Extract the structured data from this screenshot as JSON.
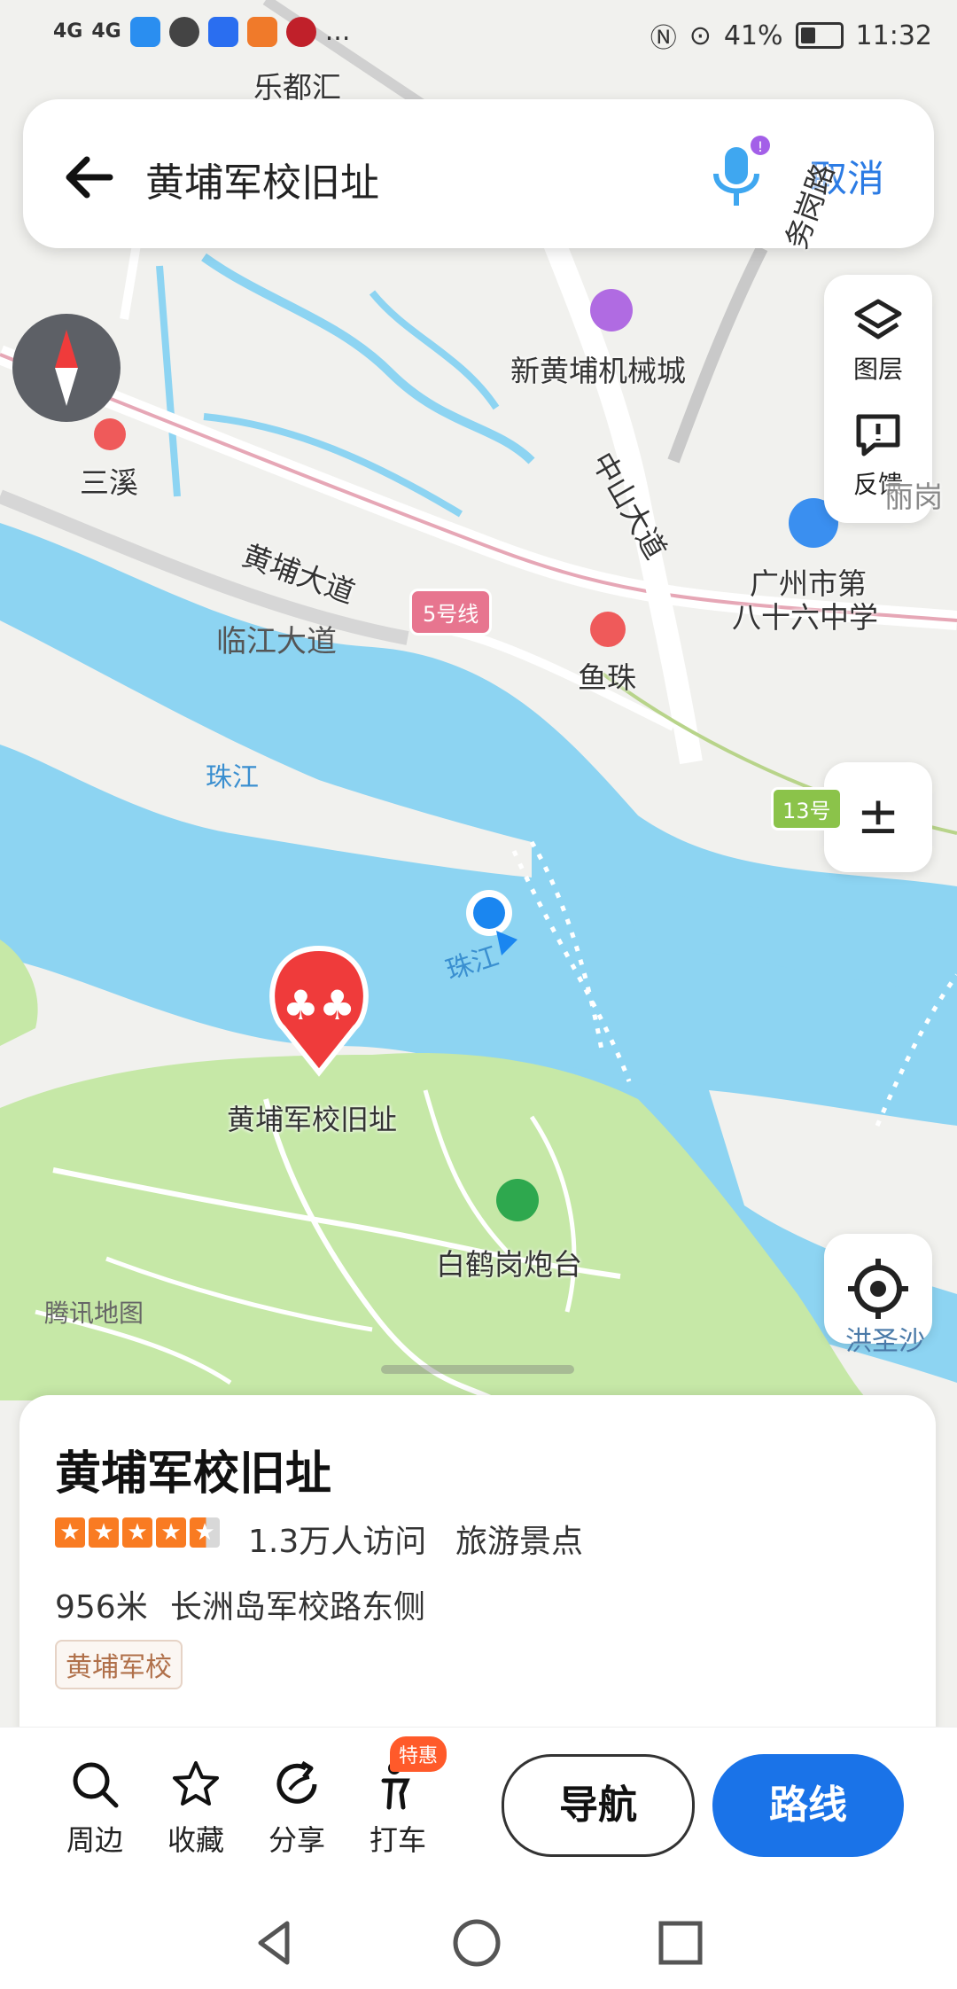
{
  "status_bar": {
    "signal1": "4G",
    "signal2": "4G",
    "more": "...",
    "battery": "41%",
    "time": "11:32"
  },
  "search": {
    "query": "黄埔军校旧址",
    "cancel_label": "取消"
  },
  "controls": {
    "layers_label": "图层",
    "feedback_label": "反馈",
    "zoom_glyph": "±"
  },
  "map": {
    "labels": {
      "ledu": "乐都汇",
      "xinhuangpu": "新黄埔机械城",
      "sanxi": "三溪",
      "huangpu_road": "黄埔大道",
      "zhongshan_road": "中山大道",
      "wu_gang": "务岗路",
      "school": "广州市第",
      "school2": "八十六中学",
      "linjiang": "临江大道",
      "yuzhu": "鱼珠",
      "zhujiang1": "珠江",
      "zhujiang2": "珠江",
      "poi": "黄埔军校旧址",
      "baihe": "白鹤岗炮台",
      "tencent": "腾讯地图",
      "gang": "丽岗",
      "shazhou": "洪圣沙"
    },
    "line5": "5号线",
    "line13": "13号"
  },
  "card": {
    "title": "黄埔军校旧址",
    "rating": 4.5,
    "visits": "1.3万人访问",
    "category": "旅游景点",
    "distance": "956米",
    "address": "长洲岛军校路东侧",
    "tag": "黄埔军校"
  },
  "actions": {
    "nearby": "周边",
    "favorite": "收藏",
    "share": "分享",
    "taxi": "打车",
    "promo": "特惠",
    "navigate": "导航",
    "route": "路线"
  },
  "colors": {
    "water": "#8dd4f2",
    "land": "#f1f1ee",
    "green": "#c6e8a7",
    "accent": "#1a73e8",
    "poi_red": "#ef3b3b"
  }
}
